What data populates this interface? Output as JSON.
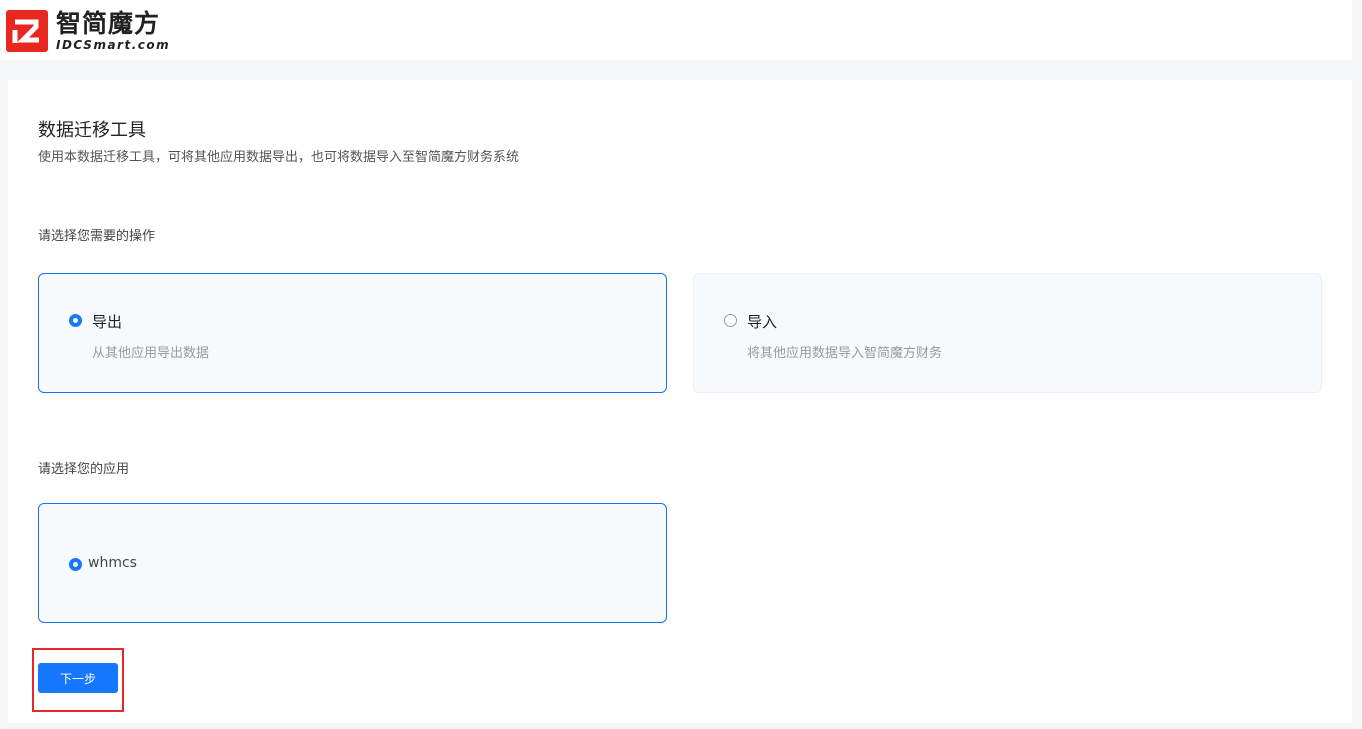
{
  "header": {
    "logo_cn": "智简魔方",
    "logo_en": "IDCSmart.com"
  },
  "main": {
    "title": "数据迁移工具",
    "subtitle": "使用本数据迁移工具，可将其他应用数据导出，也可将数据导入至智简魔方财务系统",
    "operation_label": "请选择您需要的操作",
    "operations": [
      {
        "title": "导出",
        "desc": "从其他应用导出数据",
        "selected": true
      },
      {
        "title": "导入",
        "desc": "将其他应用数据导入智简魔方财务",
        "selected": false
      }
    ],
    "app_label": "请选择您的应用",
    "apps": [
      {
        "name": "whmcs",
        "selected": true
      }
    ],
    "next_button": "下一步"
  },
  "colors": {
    "accent": "#1677ff",
    "brand_red": "#e8271f",
    "highlight": "#e8272d"
  }
}
